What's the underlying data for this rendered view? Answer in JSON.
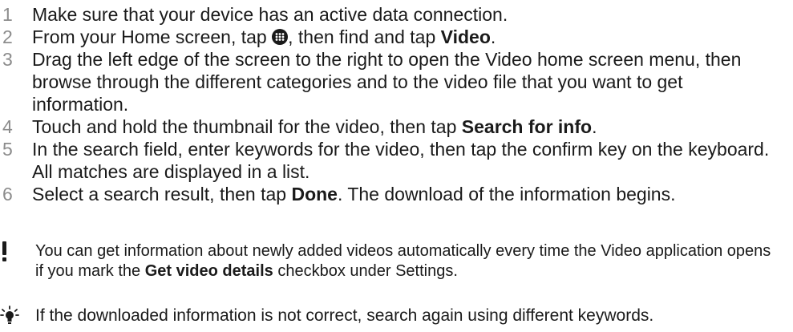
{
  "steps": [
    {
      "num": "1",
      "text_before": "Make sure that your device has an active data connection.",
      "bold": "",
      "text_after": ""
    },
    {
      "num": "2",
      "text_before": "From your Home screen, tap ",
      "icon": "apps-grid-icon",
      "text_middle": ", then find and tap ",
      "bold": "Video",
      "text_after": "."
    },
    {
      "num": "3",
      "text_before": "Drag the left edge of the screen to the right to open the Video home screen menu, then browse through the different categories and to the video file that you want to get information.",
      "bold": "",
      "text_after": ""
    },
    {
      "num": "4",
      "text_before": "Touch and hold the thumbnail for the video, then tap ",
      "bold": "Search for info",
      "text_after": "."
    },
    {
      "num": "5",
      "text_before": "In the search field, enter keywords for the video, then tap the confirm key on the keyboard. All matches are displayed in a list.",
      "bold": "",
      "text_after": ""
    },
    {
      "num": "6",
      "text_before": "Select a search result, then tap ",
      "bold": "Done",
      "text_after": ". The download of the information begins."
    }
  ],
  "notes": {
    "important": {
      "icon": "exclamation-icon",
      "text_before": "You can get information about newly added videos automatically every time the Video application opens if you mark the ",
      "bold": "Get video details",
      "text_after": " checkbox under Settings."
    },
    "tip": {
      "icon": "lightbulb-icon",
      "text": "If the downloaded information is not correct, search again using different keywords."
    }
  }
}
